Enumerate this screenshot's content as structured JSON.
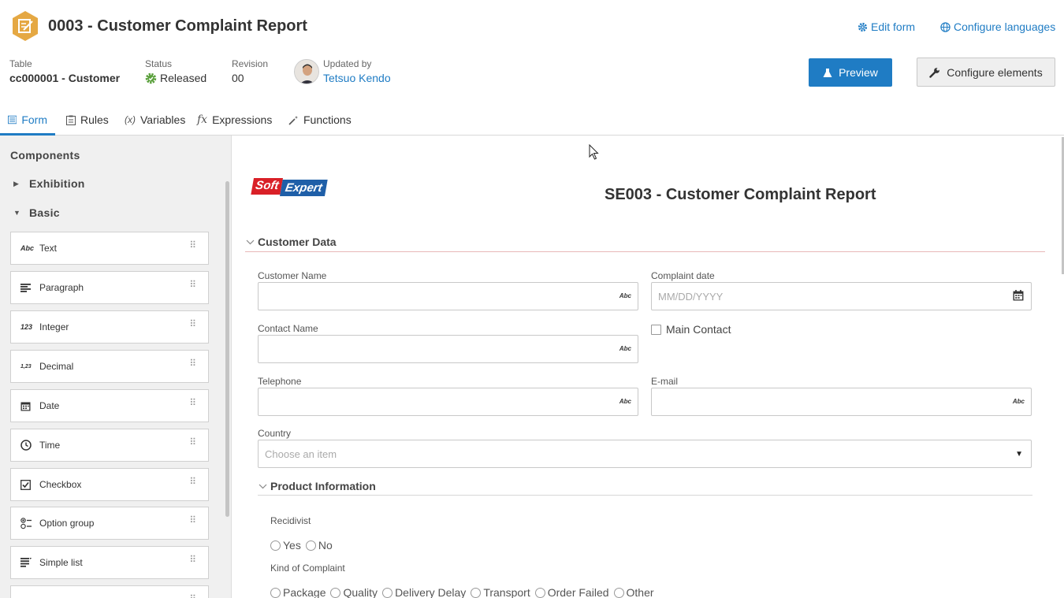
{
  "header": {
    "title": "0003 - Customer Complaint Report",
    "edit_form": "Edit form",
    "configure_languages": "Configure languages",
    "preview": "Preview",
    "configure_elements": "Configure elements",
    "accent_color": "#1f7cc4",
    "app_icon_color": "#e5a843"
  },
  "meta": {
    "table_label": "Table",
    "table_value": "cc000001 - Customer",
    "status_label": "Status",
    "status_value": "Released",
    "revision_label": "Revision",
    "revision_value": "00",
    "updated_label": "Updated by",
    "updated_value": "Tetsuo Kendo",
    "status_icon": "gear-check-icon"
  },
  "tabs": [
    {
      "label": "Form",
      "icon": "form-icon",
      "active": true
    },
    {
      "label": "Rules",
      "icon": "rules-icon"
    },
    {
      "label": "Variables",
      "icon": "variables-icon",
      "symbol": "(x)"
    },
    {
      "label": "Expressions",
      "icon": "fx-icon",
      "symbol": "fx"
    },
    {
      "label": "Functions",
      "icon": "wand-icon"
    }
  ],
  "sidebar": {
    "title": "Components",
    "groups": [
      "Exhibition",
      "Basic"
    ],
    "components": [
      {
        "label": "Text",
        "icon": "Abc"
      },
      {
        "label": "Paragraph",
        "icon": "paragraph-icon"
      },
      {
        "label": "Integer",
        "icon": "123"
      },
      {
        "label": "Decimal",
        "icon": "1,23"
      },
      {
        "label": "Date",
        "icon": "calendar-icon"
      },
      {
        "label": "Time",
        "icon": "clock-icon"
      },
      {
        "label": "Checkbox",
        "icon": "checkbox-icon"
      },
      {
        "label": "Option group",
        "icon": "option-group-icon"
      },
      {
        "label": "Simple list",
        "icon": "simple-list-icon"
      },
      {
        "label": "",
        "icon": "list-icon"
      }
    ]
  },
  "form": {
    "logo_soft": "Soft",
    "logo_expert": "Expert",
    "title": "SE003 - Customer Complaint Report",
    "section_customer": "Customer Data",
    "customer_name_label": "Customer Name",
    "complaint_date_label": "Complaint date",
    "complaint_date_placeholder": "MM/DD/YYYY",
    "contact_name_label": "Contact Name",
    "main_contact_label": "Main Contact",
    "telephone_label": "Telephone",
    "email_label": "E-mail",
    "country_label": "Country",
    "country_placeholder": "Choose an item",
    "abc": "Abc",
    "section_product": "Product Information",
    "recidivist_label": "Recidivist",
    "recidivist_options": [
      "Yes",
      "No"
    ],
    "kind_label": "Kind of Complaint",
    "kind_options": [
      "Package",
      "Quality",
      "Delivery Delay",
      "Transport",
      "Order Failed",
      "Other"
    ]
  }
}
